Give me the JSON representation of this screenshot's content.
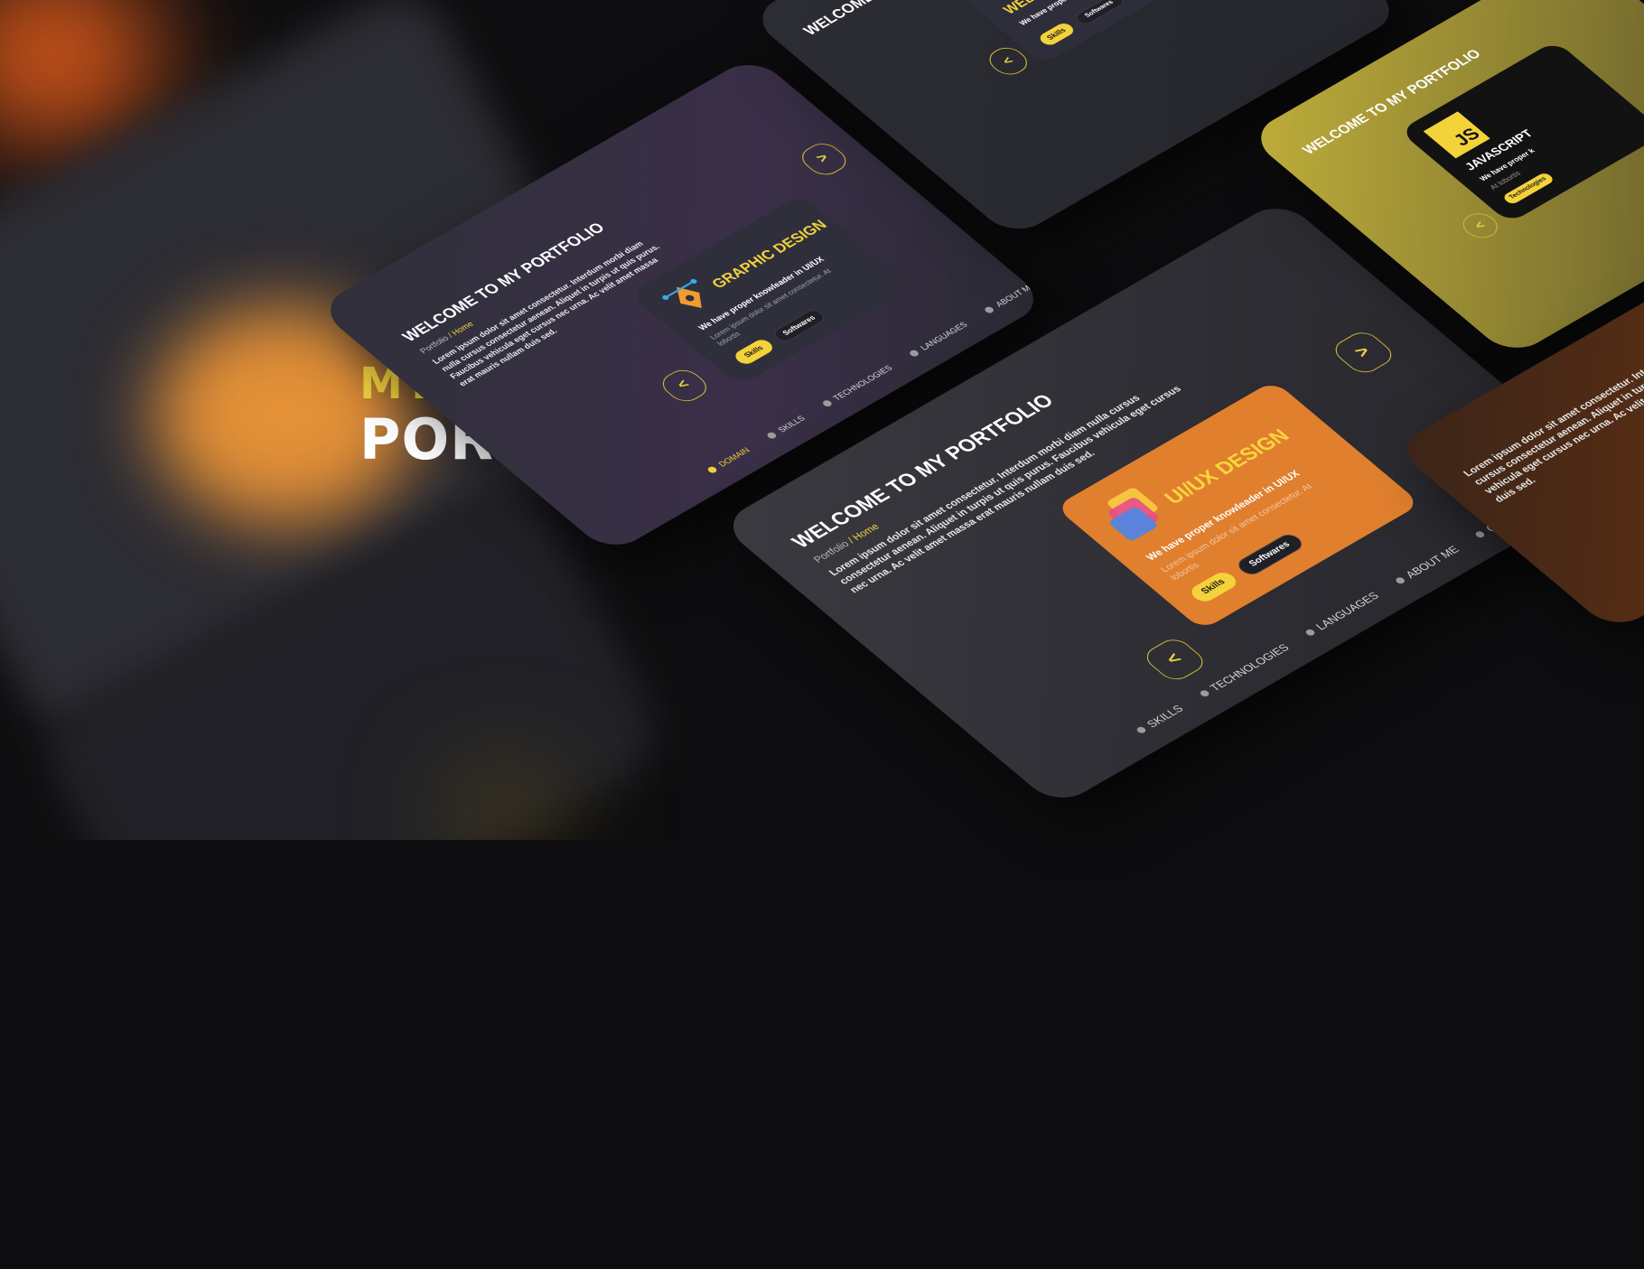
{
  "hero": {
    "line1": "MY",
    "line2": "PORTFOLIO"
  },
  "colors": {
    "accent_yellow": "#F2D33C",
    "orange_card": "#E07F2E",
    "dark_bg": "#2A2A30"
  },
  "screens": {
    "common": {
      "title": "WELCOME TO MY PORTFOLIO",
      "breadcrumb": {
        "root": "Portfolio",
        "separator": "/",
        "current": "Home"
      },
      "lorem": "Lorem ipsum dolor sit amet consectetur. Interdum morbi diam nulla cursus consectetur aenean. Aliquet in turpis ut quis purus. Faucibus vehicula eget cursus nec urna. Ac velit amet massa erat mauris nullam duis sed.",
      "card_subtitle": "We have proper knowleader in UI/UX",
      "card_lorem": "Lorem ipsum dolor sit amet consectetur. At lobortis",
      "chip_skills": "Skills",
      "chip_softwares": "Softwares",
      "arrow_left": "<",
      "arrow_right": ">"
    },
    "nav": [
      {
        "label": "DOMAIN",
        "icon": "domain-icon"
      },
      {
        "label": "SKILLS",
        "icon": "skills-icon"
      },
      {
        "label": "TECHNOLOGIES",
        "icon": "technologies-icon"
      },
      {
        "label": "LANGUAGES",
        "icon": "languages-icon"
      },
      {
        "label": "ABOUT ME",
        "icon": "info-icon"
      },
      {
        "label": "CV",
        "icon": "cv-icon"
      }
    ],
    "graphic": {
      "card_title": "GRAPHIC DESIGN",
      "icon": "pen-tool-icon"
    },
    "web": {
      "card_title": "WEB DEVELOPMENT",
      "icon": "code-window-icon"
    },
    "uiux": {
      "card_title": "UI/UX DESIGN",
      "icon": "layers-icon"
    },
    "js": {
      "card_title": "JAVASCRIPT",
      "badge": "JS",
      "icon": "javascript-icon",
      "card_subtitle": "We have proper k",
      "card_lorem": "At lobortis",
      "chip": "Technologies"
    }
  }
}
